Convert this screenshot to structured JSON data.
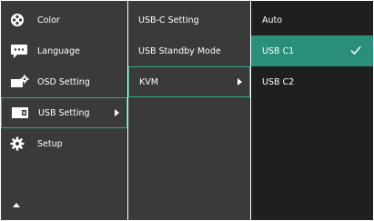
{
  "main_menu": {
    "items": [
      {
        "label": "Color",
        "icon": "color-icon"
      },
      {
        "label": "Language",
        "icon": "language-icon"
      },
      {
        "label": "OSD Setting",
        "icon": "osd-setting-icon"
      },
      {
        "label": "USB Setting",
        "icon": "usb-setting-icon"
      },
      {
        "label": "Setup",
        "icon": "setup-icon"
      }
    ],
    "selected_index": 3,
    "scroll_icon": "up-arrow-icon"
  },
  "sub_menu": {
    "items": [
      {
        "label": "USB-C Setting"
      },
      {
        "label": "USB Standby Mode"
      },
      {
        "label": "KVM"
      }
    ],
    "selected_index": 2
  },
  "options_menu": {
    "items": [
      {
        "label": "Auto"
      },
      {
        "label": "USB C1",
        "checked": true
      },
      {
        "label": "USB C2"
      }
    ],
    "highlighted_index": 1
  },
  "colors": {
    "panel": "#3a3a3a",
    "options_panel": "#1f1f1f",
    "accent": "#2ea889",
    "highlight": "#2a8f79",
    "text": "#ffffff"
  }
}
